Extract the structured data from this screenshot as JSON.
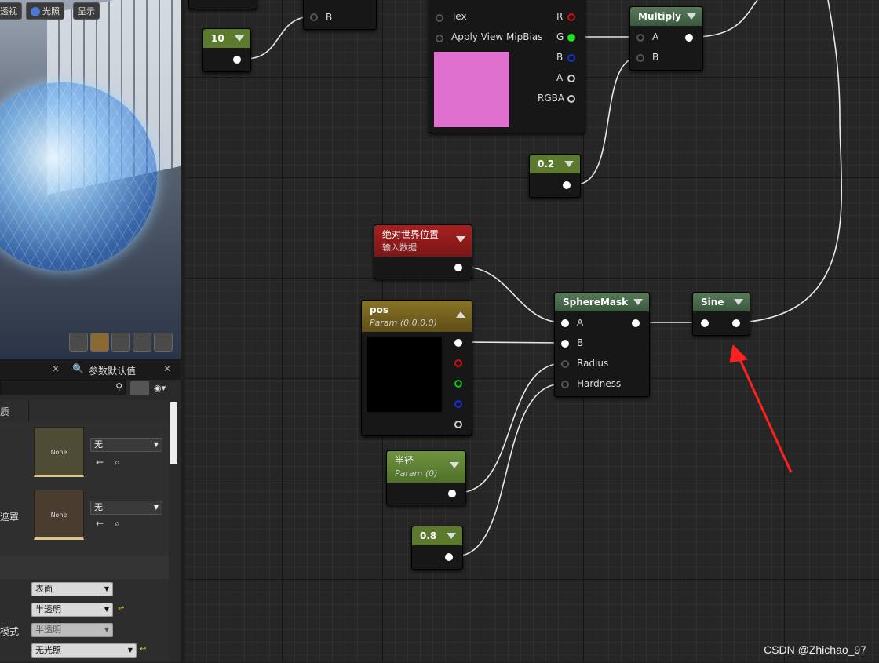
{
  "viewport": {
    "buttons": [
      {
        "label": "透视"
      },
      {
        "label": "光照"
      },
      {
        "label": "显示"
      }
    ]
  },
  "panel": {
    "tab_label": "参数默认值",
    "row_label_1": "质",
    "row_label_2": "遮罩",
    "row_label_3": "模式",
    "thumb1_label": "None",
    "thumb2_label": "None",
    "asset_drop1": "无",
    "asset_drop2": "无",
    "prop_drop1": "表面",
    "prop_drop2": "半透明",
    "prop_drop3": "半透明",
    "prop_drop4": "无光照"
  },
  "nodes": {
    "const10": {
      "value": "10"
    },
    "texnode": {
      "pin_tex": "Tex",
      "pin_mip": "Apply View MipBias",
      "out_r": "R",
      "out_g": "G",
      "out_b": "B",
      "out_a": "A",
      "out_rgba": "RGBA"
    },
    "topnode": {
      "pin_b": "B"
    },
    "multiply": {
      "title": "Multiply",
      "pin_a": "A",
      "pin_b": "B"
    },
    "const02": {
      "value": "0.2"
    },
    "worldpos": {
      "title": "绝对世界位置",
      "subtitle": "输入数据"
    },
    "pos": {
      "title": "pos",
      "subtitle": "Param (0,0,0,0)"
    },
    "spheremask": {
      "title": "SphereMask",
      "pin_a": "A",
      "pin_b": "B",
      "pin_radius": "Radius",
      "pin_hardness": "Hardness"
    },
    "sine": {
      "title": "Sine"
    },
    "radius": {
      "title": "半径",
      "subtitle": "Param (0)"
    },
    "const08": {
      "value": "0.8"
    }
  },
  "colors": {
    "constant_header": "#5c7a2e",
    "world_header": "#9a1e1e",
    "param_vector_header": "#7a6320",
    "math_header": "#3d5c40",
    "texture_preview": "#e070d0",
    "annotation_arrow": "#ff2020"
  },
  "watermark": "CSDN @Zhichao_97"
}
